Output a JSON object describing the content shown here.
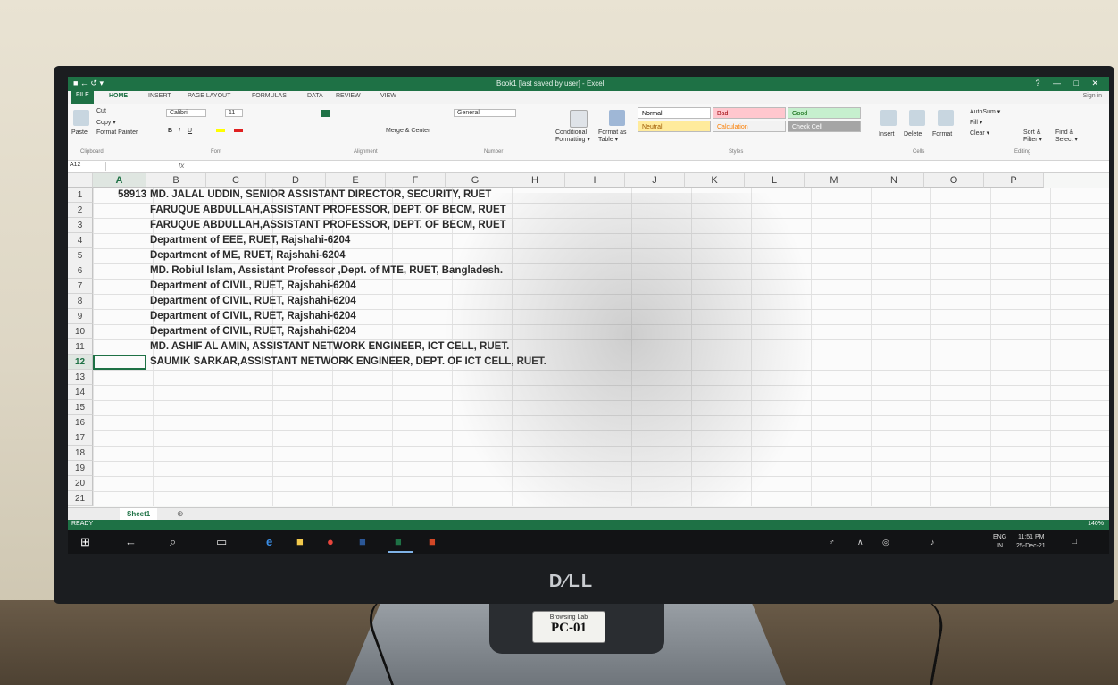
{
  "window": {
    "title": "Book1 [last saved by user] - Excel",
    "qat": "■ ← ↺ ▾",
    "controls": "? — □ ✕"
  },
  "tabs": [
    {
      "label": "FILE"
    },
    {
      "label": "HOME"
    },
    {
      "label": "INSERT"
    },
    {
      "label": "PAGE LAYOUT"
    },
    {
      "label": "FORMULAS"
    },
    {
      "label": "DATA"
    },
    {
      "label": "REVIEW"
    },
    {
      "label": "VIEW"
    }
  ],
  "sign_in": "Sign in",
  "ribbon": {
    "clipboard": {
      "cut": "Cut",
      "copy": "Copy ▾",
      "format_painter": "Format Painter",
      "paste": "Paste",
      "group": "Clipboard"
    },
    "font": {
      "name": "Calibri",
      "size": "11",
      "group": "Font",
      "bold": "B",
      "italic": "I",
      "underline": "U"
    },
    "alignment": {
      "merge": "Merge & Center",
      "group": "Alignment"
    },
    "number": {
      "format": "General",
      "group": "Number"
    },
    "styles": {
      "conditional": "Conditional Formatting ▾",
      "format_table": "Format as Table ▾",
      "cells": [
        {
          "label": "Normal",
          "bg": "#ffffff",
          "fg": "#000000"
        },
        {
          "label": "Bad",
          "bg": "#ffc7ce",
          "fg": "#9c0006"
        },
        {
          "label": "Good",
          "bg": "#c6efce",
          "fg": "#006100"
        },
        {
          "label": "Neutral",
          "bg": "#ffeb9c",
          "fg": "#9c5700"
        },
        {
          "label": "Calculation",
          "bg": "#f2f2f2",
          "fg": "#fa7d00"
        },
        {
          "label": "Check Cell",
          "bg": "#a5a5a5",
          "fg": "#ffffff"
        }
      ],
      "group": "Styles"
    },
    "cells": {
      "insert": "Insert",
      "delete": "Delete",
      "format": "Format",
      "group": "Cells"
    },
    "editing": {
      "autosum": "AutoSum ▾",
      "fill": "Fill ▾",
      "clear": "Clear ▾",
      "sort": "Sort & Filter ▾",
      "find": "Find & Select ▾",
      "group": "Editing"
    }
  },
  "formula_bar": {
    "name_box": "A12",
    "fx": "fx"
  },
  "columns": [
    "A",
    "B",
    "C",
    "D",
    "E",
    "F",
    "G",
    "H",
    "I",
    "J",
    "K",
    "L",
    "M",
    "N",
    "O",
    "P"
  ],
  "selected_column": "A",
  "rows": [
    {
      "num": "1",
      "a": "58913",
      "b": "MD. JALAL UDDIN, SENIOR ASSISTANT DIRECTOR, SECURITY, RUET"
    },
    {
      "num": "2",
      "a": "",
      "b": "FARUQUE ABDULLAH,ASSISTANT PROFESSOR, DEPT. OF BECM, RUET"
    },
    {
      "num": "3",
      "a": "",
      "b": "FARUQUE ABDULLAH,ASSISTANT PROFESSOR, DEPT. OF BECM, RUET"
    },
    {
      "num": "4",
      "a": "",
      "b": "Department of EEE, RUET, Rajshahi-6204"
    },
    {
      "num": "5",
      "a": "",
      "b": "Department of ME, RUET, Rajshahi-6204"
    },
    {
      "num": "6",
      "a": "",
      "b": " MD. Robiul Islam, Assistant Professor ,Dept. of MTE, RUET, Bangladesh."
    },
    {
      "num": "7",
      "a": "",
      "b": "Department of CIVIL, RUET, Rajshahi-6204"
    },
    {
      "num": "8",
      "a": "",
      "b": "Department of CIVIL, RUET, Rajshahi-6204"
    },
    {
      "num": "9",
      "a": "",
      "b": "Department of CIVIL, RUET, Rajshahi-6204"
    },
    {
      "num": "10",
      "a": "",
      "b": "Department of CIVIL, RUET, Rajshahi-6204"
    },
    {
      "num": "11",
      "a": "",
      "b": "MD. ASHIF AL AMIN, ASSISTANT NETWORK ENGINEER, ICT CELL, RUET."
    },
    {
      "num": "12",
      "a": "",
      "b": "SAUMIK SARKAR,ASSISTANT NETWORK ENGINEER, DEPT. OF ICT CELL, RUET."
    },
    {
      "num": "13",
      "a": "",
      "b": ""
    },
    {
      "num": "14",
      "a": "",
      "b": ""
    },
    {
      "num": "15",
      "a": "",
      "b": ""
    },
    {
      "num": "16",
      "a": "",
      "b": ""
    },
    {
      "num": "17",
      "a": "",
      "b": ""
    },
    {
      "num": "18",
      "a": "",
      "b": ""
    },
    {
      "num": "19",
      "a": "",
      "b": ""
    },
    {
      "num": "20",
      "a": "",
      "b": ""
    },
    {
      "num": "21",
      "a": "",
      "b": ""
    }
  ],
  "selected_row": "12",
  "sheet": {
    "tab": "Sheet1",
    "add": "⊕"
  },
  "status": {
    "ready": "READY",
    "zoom": "140%"
  },
  "taskbar": {
    "icons": [
      "windows-icon",
      "back-icon",
      "search-icon",
      "task-view-icon",
      "edge-icon",
      "file-explorer-icon",
      "chrome-icon",
      "word-icon",
      "excel-icon",
      "powerpoint-icon"
    ],
    "tray": {
      "lang": "ENG",
      "region": "IN",
      "time": "11:51 PM",
      "date": "25-Dec-21"
    }
  },
  "monitor": {
    "brand": "D∕LL",
    "label_line1": "Browsing Lab",
    "label_line2": "PC-01",
    "label_line3": ""
  }
}
